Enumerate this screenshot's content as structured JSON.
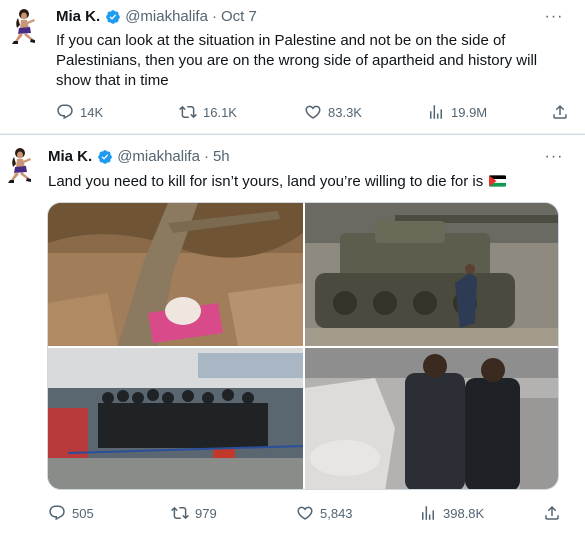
{
  "tweets": [
    {
      "name": "Mia K.",
      "handle": "@miakhalifa",
      "separator": "·",
      "time": "Oct 7",
      "text": "If you can look at the situation in Palestine and not be on the side of Palestinians, then you are on the wrong side of apartheid and history will show that in time",
      "more": "···",
      "stats": {
        "replies": "14K",
        "reposts": "16.1K",
        "likes": "83.3K",
        "views": "19.9M"
      }
    },
    {
      "name": "Mia K.",
      "handle": "@miakhalifa",
      "separator": "·",
      "time": "5h",
      "text": "Land you need to kill for isn’t yours, land you’re willing to die for is",
      "emoji": "palestine-flag-emoji",
      "more": "···",
      "media_count": 4,
      "stats": {
        "replies": "505",
        "reposts": "979",
        "likes": "5,843",
        "views": "398.8K"
      }
    }
  ],
  "colors": {
    "text": "#0f1419",
    "secondary": "#536471",
    "verified": "#1d9bf0",
    "divider": "#cfd9de"
  },
  "icons": [
    "reply-icon",
    "repost-icon",
    "like-icon",
    "views-icon",
    "share-icon",
    "verified-badge-icon",
    "more-icon"
  ]
}
